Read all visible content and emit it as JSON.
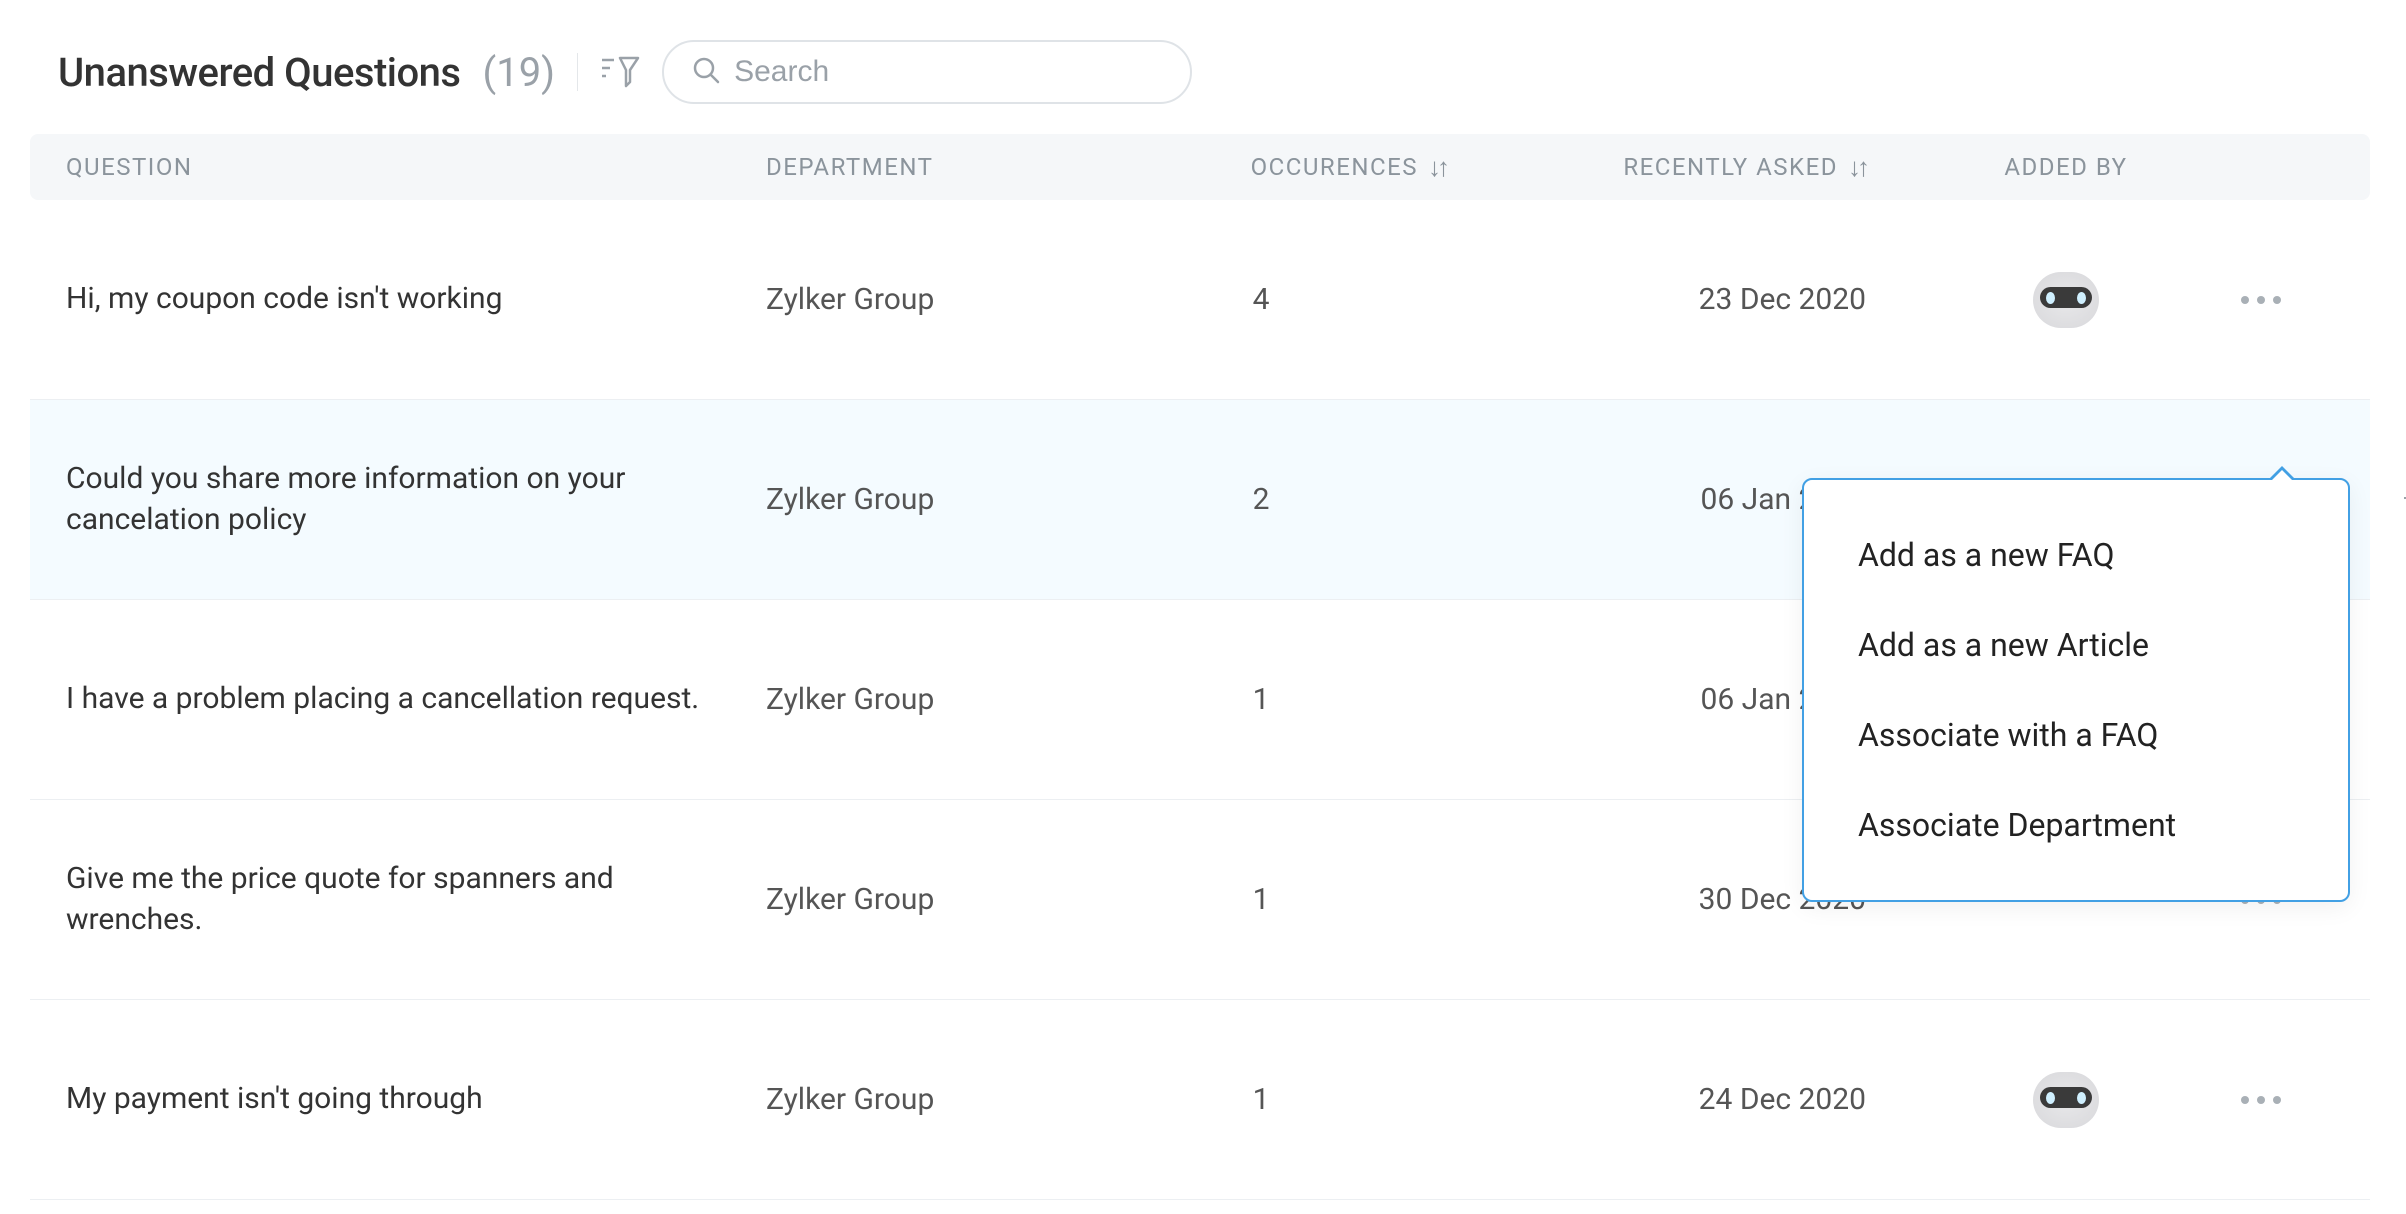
{
  "header": {
    "title": "Unanswered Questions",
    "count": "(19)",
    "search_placeholder": "Search"
  },
  "columns": {
    "question": "QUESTION",
    "department": "DEPARTMENT",
    "occurrences": "OCCURENCES",
    "recently_asked": "RECENTLY ASKED",
    "added_by": "ADDED BY"
  },
  "rows": [
    {
      "question": "Hi, my coupon code isn't working",
      "department": "Zylker Group",
      "occurrences": "4",
      "date": "23 Dec 2020",
      "avatar": true
    },
    {
      "question": "Could you share more information on your cancelation policy",
      "department": "Zylker Group",
      "occurrences": "2",
      "date": "06 Jan 2021",
      "avatar": false,
      "selected": true
    },
    {
      "question": "I have a problem placing a cancellation request.",
      "department": "Zylker Group",
      "occurrences": "1",
      "date": "06 Jan 2021",
      "avatar": false
    },
    {
      "question": "Give me the price quote for spanners and wrenches.",
      "department": "Zylker Group",
      "occurrences": "1",
      "date": "30 Dec 2020",
      "avatar": false
    },
    {
      "question": "My payment isn't going through",
      "department": "Zylker Group",
      "occurrences": "1",
      "date": "24 Dec 2020",
      "avatar": true
    }
  ],
  "popup": {
    "items": [
      "Add as a new FAQ",
      "Add as a new Article",
      "Associate with a FAQ",
      "Associate Department"
    ]
  }
}
